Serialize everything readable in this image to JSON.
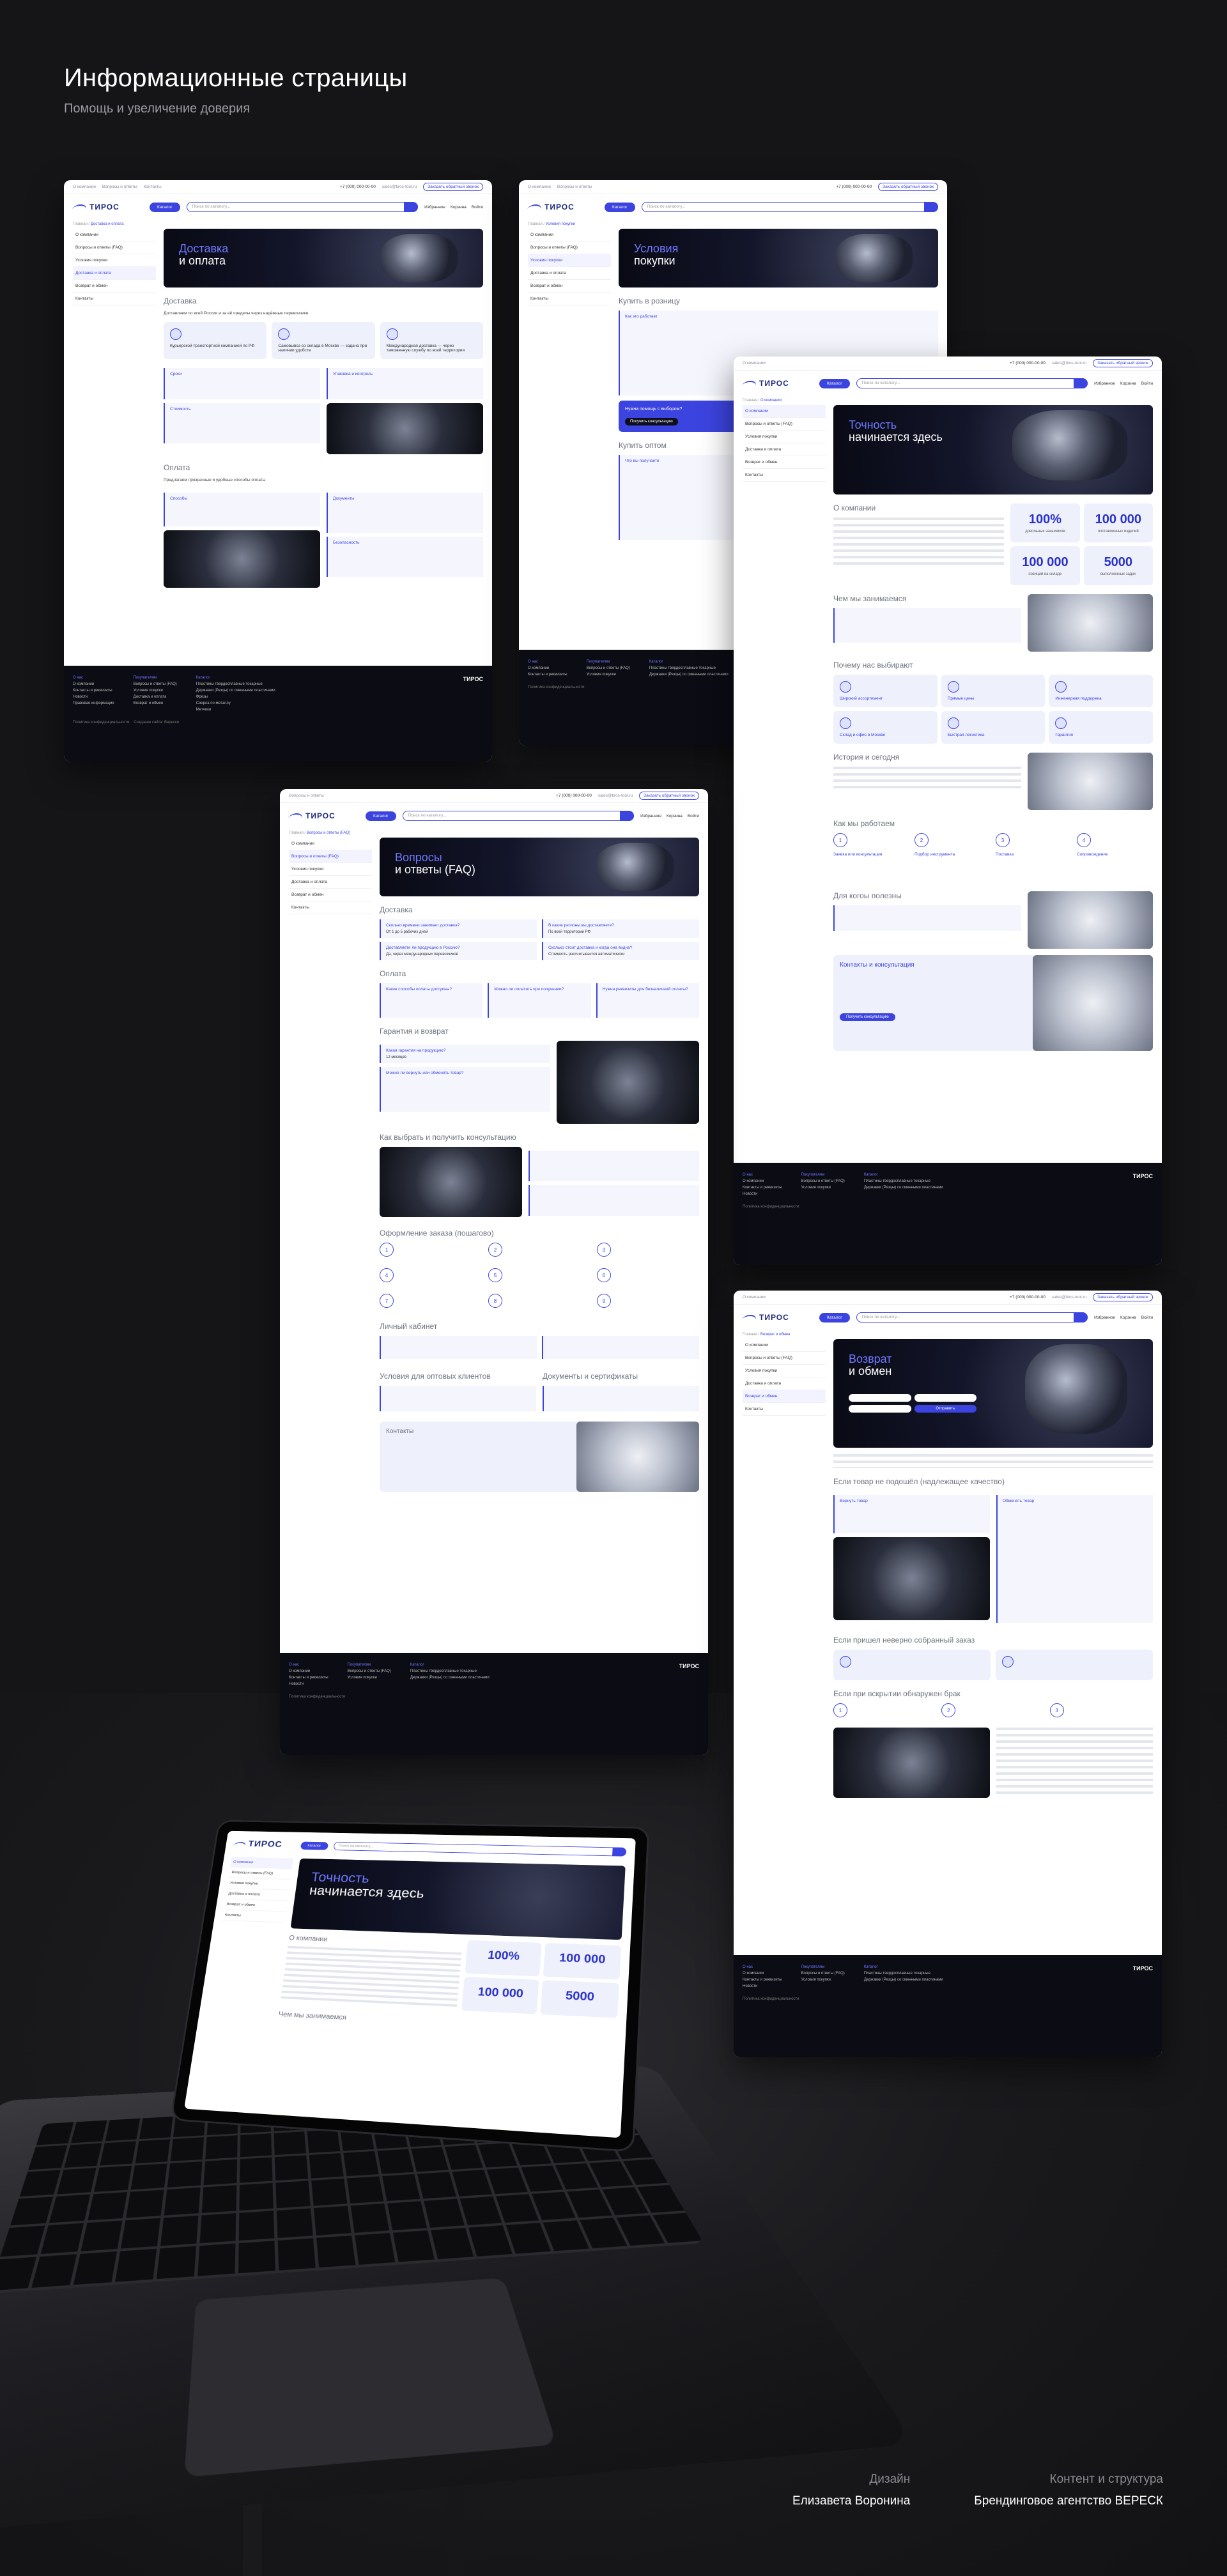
{
  "header": {
    "title": "Информационные страницы",
    "subtitle": "Помощь и увеличение доверия"
  },
  "site": {
    "logo": "ТИРОС",
    "catalog": "Каталог",
    "search_placeholder": "Поиск по каталогу...",
    "phone": "+7 (000) 000-00-00",
    "email": "sales@tiros-tool.ru",
    "callback": "Заказать обратный звонок",
    "top_links": [
      "О компании",
      "Вопросы и ответы",
      "Контакты"
    ],
    "icons": [
      "Избранное",
      "Корзина",
      "Войти"
    ],
    "sidebar": [
      "О компании",
      "Вопросы и ответы (FAQ)",
      "Условия покупки",
      "Доставка и оплата",
      "Возврат и обмен",
      "Контакты"
    ],
    "footer": {
      "col1_title": "О нас",
      "col1": [
        "О компании",
        "Контакты и реквизиты",
        "Новости",
        "Правовая информация"
      ],
      "col2_title": "Покупателям",
      "col2": [
        "Вопросы и ответы (FAQ)",
        "Условия покупки",
        "Доставка и оплата",
        "Возврат и обмен"
      ],
      "col3_title": "Каталог",
      "col3": [
        "Пластины твердосплавные токарные",
        "Державки (Резцы) со сменными пластинами",
        "Фрезы",
        "Сверла по металлу",
        "Метчики"
      ],
      "copyright": "Политика конфиденциальности",
      "made": "Создание сайта: Верески"
    }
  },
  "delivery": {
    "crumb": "Доставка и оплата",
    "banner1": "Доставка",
    "banner2": "и оплата",
    "sec1": "Доставка",
    "intro": "Доставляем по всей России и за её пределы через надёжные перевозчики",
    "cards": [
      "Курьерской транспортной компанией по РФ",
      "Самовывоз со склада в Москве — задача при наличии удобств",
      "Международная доставка — через таможенную службу по всей территории"
    ],
    "h_terms": "Сроки",
    "h_pack": "Упаковка и контроль",
    "h_cost": "Стоимость",
    "sec2": "Оплата",
    "pay_intro": "Предлагаем прозрачные и удобные способы оплаты:",
    "h_ways": "Способы",
    "h_docs": "Документы",
    "h_safe": "Безопасность"
  },
  "purchase": {
    "crumb": "Условия покупки",
    "banner1": "Условия",
    "banner2": "покупки",
    "sec1": "Купить в розницу",
    "h_how": "Как это работает",
    "h_help": "Нужна помощь с выбором?",
    "help_btn": "Получить консультацию",
    "sec2": "Купить оптом",
    "h_get": "Что вы получаете"
  },
  "about": {
    "crumb": "О компании",
    "banner1": "Точность",
    "banner2": "начинается здесь",
    "sec1": "О компании",
    "stats": [
      {
        "n": "100%",
        "l": "довольных заказчиков"
      },
      {
        "n": "100 000",
        "l": "поставленных изделий"
      },
      {
        "n": "100 000",
        "l": "позиций на складе"
      },
      {
        "n": "5000",
        "l": "выполненных задач"
      }
    ],
    "sec2": "Чем мы занимаемся",
    "sec3": "Почему нас выбирают",
    "why": [
      "Широкий ассортимент",
      "Прямые цены",
      "Инженерная поддержка",
      "Склад и офис в Москве",
      "Быстрая логистика",
      "Гарантия"
    ],
    "sec4": "История и сегодня",
    "sec5": "Как мы работаем",
    "steps": [
      {
        "n": "1",
        "t": "Заявка или консультация"
      },
      {
        "n": "2",
        "t": "Подбор инструмента"
      },
      {
        "n": "3",
        "t": "Поставка"
      },
      {
        "n": "4",
        "t": "Сопровождение"
      }
    ],
    "sec6": "Для когоы полезны",
    "sec7": "Контакты и консультация",
    "consult_btn": "Получить консультацию"
  },
  "faq": {
    "crumb": "Вопросы и ответы (FAQ)",
    "banner1": "Вопросы",
    "banner2": "и ответы (FAQ)",
    "sec_del": "Доставка",
    "q1": "Сколько времени занимает доставка?",
    "a1": "От 1 до 5 рабочих дней",
    "q2": "В какие регионы вы доставляете?",
    "a2": "По всей территории РФ",
    "q3": "Доставляете ли продукцию в Россию?",
    "a3": "Да, через международных перевозчиков",
    "q4": "Сколько стоит доставка и когда она видна?",
    "a4": "Стоимость рассчитывается автоматически",
    "sec_pay": "Оплата",
    "p1": "Какие способы оплаты доступны?",
    "p2": "Можно ли оплатить при получении?",
    "p3": "Нужна реквизиты для безналичной оплаты?",
    "sec_warr": "Гарантия и возврат",
    "w1": "Какая гарантия на продукцию?",
    "w1a": "12 месяцев",
    "w2": "Можно ли вернуть или обменять товар?",
    "sec_cons": "Как выбрать и получить консультацию",
    "sec_order": "Оформление заказа (пошагово)",
    "order_steps": [
      "1",
      "2",
      "3",
      "4",
      "5",
      "6",
      "7",
      "8",
      "9"
    ],
    "sec_lk": "Личный кабинет",
    "sec_opt": "Условия для оптовых клиентов",
    "sec_docs": "Документы и сертификаты",
    "sec_cont": "Контакты"
  },
  "returns": {
    "crumb": "Возврат и обмен",
    "banner1": "Возврат",
    "banner2": "и обмен",
    "form_btn": "Отправить",
    "sec1": "Если товар не подошёл (надлежащее качество)",
    "h_return": "Вернуть товар",
    "h_exchange": "Обменять товар",
    "sec2": "Если пришел неверно собранный заказ",
    "sec3": "Если при вскрытии обнаружен брак"
  },
  "credits": {
    "design_label": "Дизайн",
    "design": "Елизавета Воронина",
    "content_label": "Контент и структура",
    "content": "Брендинговое агентство ВЕРЕСК"
  }
}
